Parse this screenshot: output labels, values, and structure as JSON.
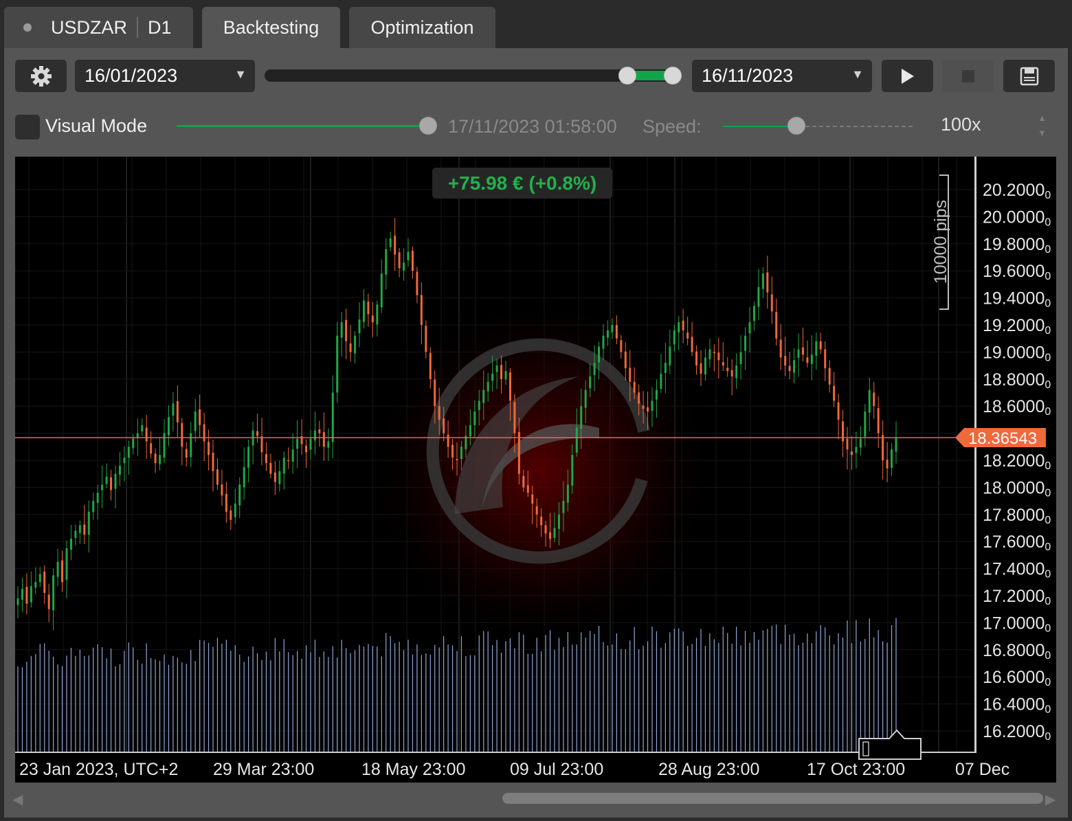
{
  "tabs": {
    "symbol": "USDZAR",
    "timeframe": "D1",
    "backtesting": "Backtesting",
    "optimization": "Optimization"
  },
  "toolbar": {
    "start_date": "16/01/2023",
    "end_date": "16/11/2023",
    "range_start_fraction": 0.88,
    "range_end_fraction": 1.0,
    "icons": [
      "gear-icon",
      "play-icon",
      "stop-icon",
      "save-icon"
    ]
  },
  "visual_mode": {
    "label": "Visual Mode",
    "checked": false,
    "current_time": "17/11/2023 01:58:00",
    "speed_label": "Speed:",
    "speed_value": "100x"
  },
  "chart": {
    "pnl": "+75.98 € (+0.8%)",
    "current_price": "18.36543",
    "pips_label": "10000 pips",
    "y_ticks": [
      "20.2000",
      "20.0000",
      "19.8000",
      "19.6000",
      "19.4000",
      "19.2000",
      "19.0000",
      "18.8000",
      "18.6000",
      "18.2000",
      "18.0000",
      "17.8000",
      "17.6000",
      "17.4000",
      "17.2000",
      "17.0000",
      "16.8000",
      "16.6000",
      "16.4000",
      "16.2000"
    ],
    "y_tick_suffix": "0",
    "x_ticks": [
      "23 Jan 2023, UTC+2",
      "29 Mar 23:00",
      "18 May 23:00",
      "09 Jul 23:00",
      "28 Aug 23:00",
      "17 Oct 23:00",
      "07 Dec"
    ],
    "colors": {
      "up": "#1fa845",
      "down": "#f0693a",
      "price_line": "#f0693a",
      "volume": "#8fa8d8",
      "pnl": "#22b04a"
    }
  },
  "chart_data": {
    "type": "candlestick",
    "symbol": "USDZAR",
    "timeframe": "D1",
    "ylim": [
      16.1,
      20.3
    ],
    "closes": [
      17.18,
      17.25,
      17.14,
      17.27,
      17.3,
      17.36,
      17.22,
      17.1,
      17.35,
      17.45,
      17.3,
      17.55,
      17.62,
      17.68,
      17.72,
      17.65,
      17.82,
      17.9,
      17.96,
      18.02,
      18.08,
      17.98,
      18.1,
      18.16,
      18.22,
      18.3,
      18.36,
      18.4,
      18.46,
      18.34,
      18.25,
      18.18,
      18.24,
      18.4,
      18.52,
      18.62,
      18.48,
      18.3,
      18.22,
      18.4,
      18.56,
      18.46,
      18.34,
      18.24,
      18.12,
      18.02,
      17.94,
      17.82,
      17.76,
      17.88,
      18.02,
      18.15,
      18.3,
      18.42,
      18.38,
      18.26,
      18.18,
      18.1,
      18.04,
      18.12,
      18.22,
      18.2,
      18.28,
      18.36,
      18.32,
      18.26,
      18.36,
      18.42,
      18.4,
      18.3,
      18.34,
      18.7,
      19.12,
      19.22,
      19.08,
      19.0,
      19.12,
      19.24,
      19.38,
      19.28,
      19.22,
      19.35,
      19.58,
      19.76,
      19.84,
      19.72,
      19.62,
      19.66,
      19.74,
      19.6,
      19.42,
      19.2,
      19.0,
      18.8,
      18.6,
      18.5,
      18.4,
      18.3,
      18.22,
      18.2,
      18.3,
      18.38,
      18.46,
      18.56,
      18.64,
      18.72,
      18.78,
      18.84,
      18.9,
      18.8,
      18.86,
      18.64,
      18.4,
      18.1,
      18.0,
      17.96,
      17.88,
      17.8,
      17.72,
      17.66,
      17.62,
      17.7,
      17.8,
      17.9,
      18.02,
      18.24,
      18.44,
      18.6,
      18.72,
      18.82,
      18.92,
      19.04,
      19.12,
      19.16,
      19.2,
      19.1,
      19.0,
      18.88,
      18.78,
      18.7,
      18.62,
      18.58,
      18.56,
      18.64,
      18.72,
      18.84,
      18.92,
      19.04,
      19.16,
      19.22,
      19.16,
      19.1,
      19.0,
      18.9,
      18.84,
      18.96,
      19.02,
      19.0,
      18.94,
      18.9,
      18.86,
      18.82,
      18.9,
      19.0,
      19.12,
      19.22,
      19.34,
      19.48,
      19.58,
      19.44,
      19.3,
      19.1,
      18.96,
      18.9,
      18.86,
      18.94,
      19.02,
      18.98,
      18.92,
      18.98,
      19.08,
      19.02,
      18.88,
      18.76,
      18.64,
      18.5,
      18.34,
      18.28,
      18.24,
      18.3,
      18.36,
      18.56,
      18.72,
      18.6,
      18.4,
      18.2,
      18.14,
      18.28,
      18.37
    ],
    "current_price": 18.36543,
    "volume_relative": "per-candle bars at bottom, higher in Aug–Nov"
  }
}
